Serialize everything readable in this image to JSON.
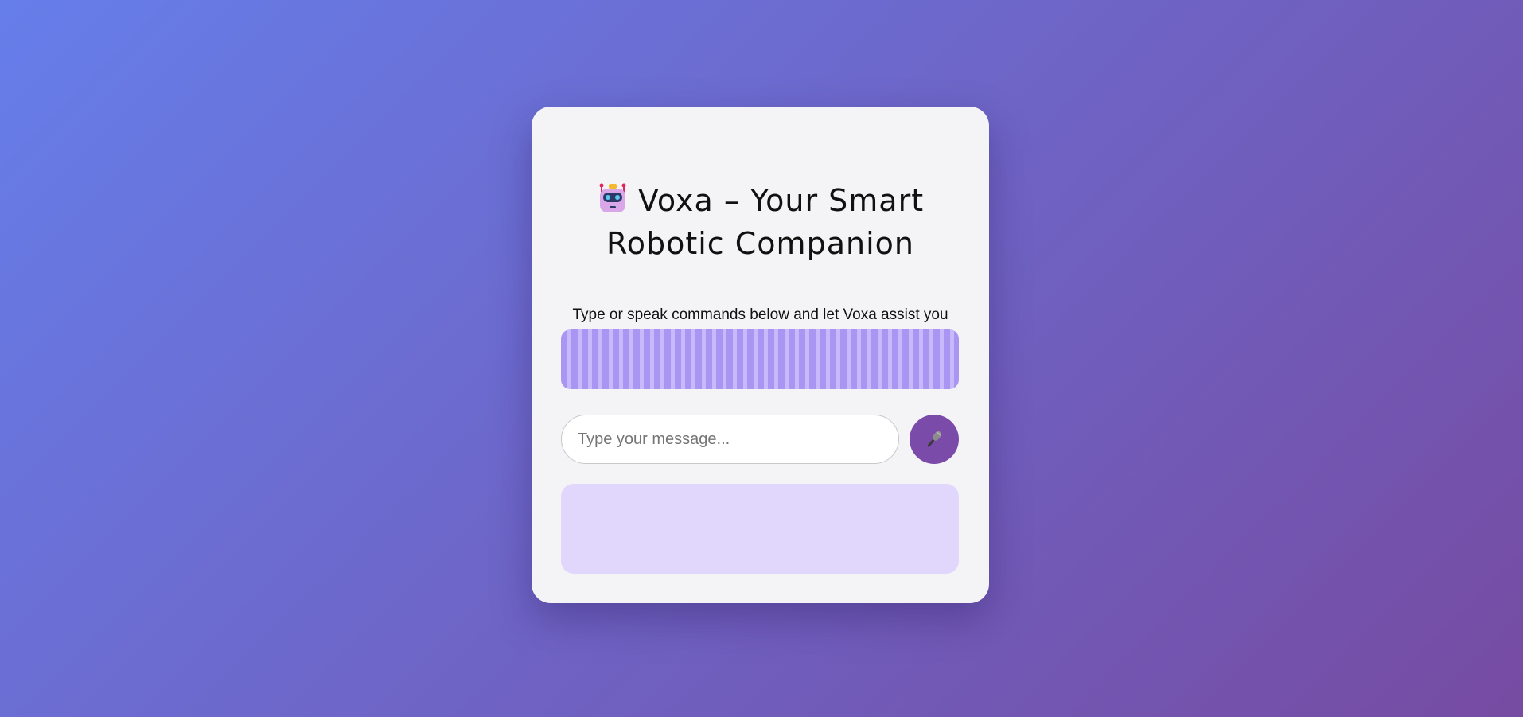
{
  "header": {
    "title": "Voxa – Your Smart Robotic Companion",
    "title_icon": "robot-face-icon"
  },
  "subtitle": "Type or speak commands below and let Voxa assist you",
  "input": {
    "placeholder": "Type your message...",
    "value": ""
  },
  "mic_button": {
    "icon": "microphone-icon"
  },
  "response": {
    "text": ""
  },
  "colors": {
    "background_start": "#667eea",
    "background_end": "#764ba2",
    "card": "#f4f4f7",
    "visualizer_bar": "#a996f2",
    "visualizer_gap": "#c7b9fa",
    "mic_button": "#7a4ba8",
    "response_box": "#e1d6fc"
  }
}
